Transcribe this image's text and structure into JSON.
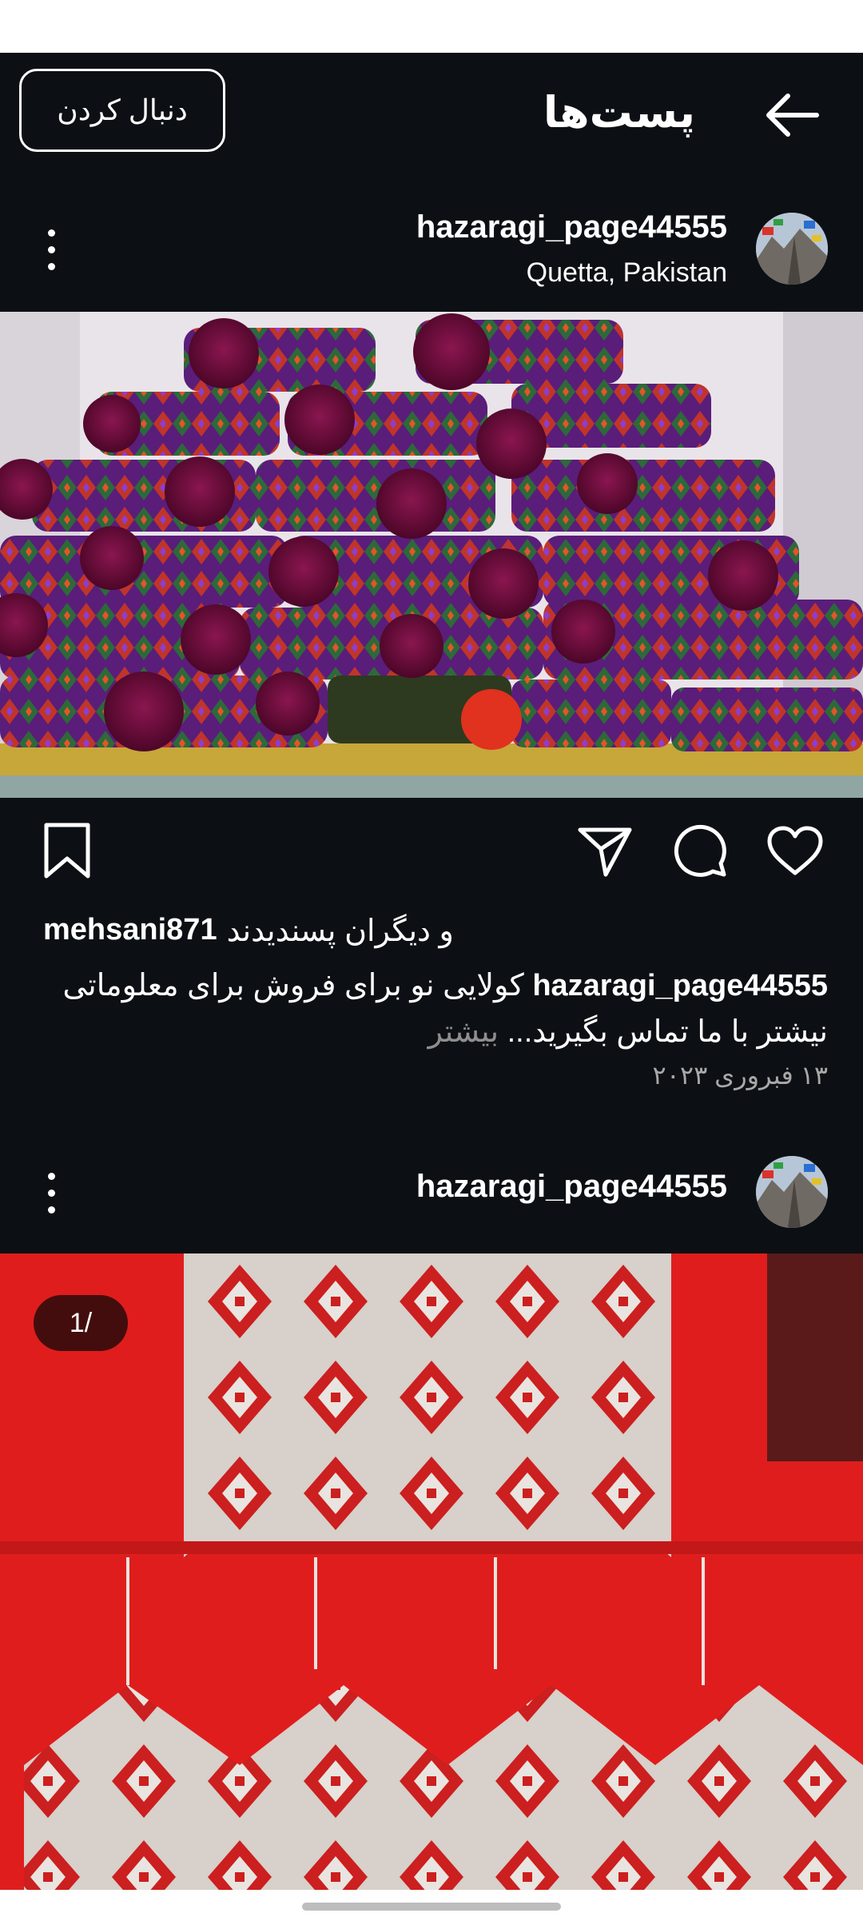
{
  "header": {
    "title": "پست‌ها",
    "follow_label": "دنبال کردن",
    "back_icon": "arrow-left-icon"
  },
  "posts": [
    {
      "username": "hazaragi_page44555",
      "location": "Quetta, Pakistan",
      "liked_by": "mehsani871",
      "likes_suffix": "و دیگران پسندیدند",
      "caption": "کولایی نو برای فروش برای معلوماتی نیشتر با ما تماس بگیرید...",
      "caption_more": "بیشتر",
      "date": "۱۳ فبروری ۲۰۲۳",
      "actions": [
        "heart-icon",
        "comment-icon",
        "share-icon",
        "bookmark-icon"
      ]
    },
    {
      "username": "hazaragi_page44555",
      "counter": "1/"
    }
  ],
  "colors": {
    "background": "#0c1014",
    "text": "#ffffff",
    "muted": "#8e8e8e",
    "embroidery_red": "#d81c1c",
    "hat_purple": "#6a1a8c",
    "pompom": "#6b0a3a"
  }
}
